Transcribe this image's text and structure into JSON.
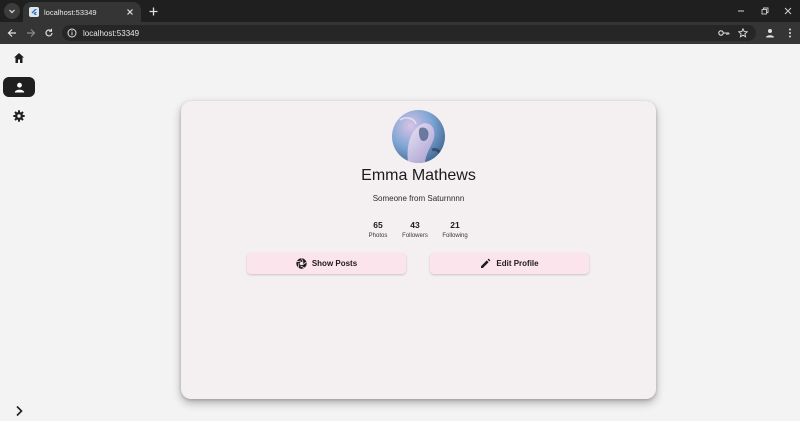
{
  "browser": {
    "tab_title": "localhost:53349",
    "url": "localhost:53349"
  },
  "nav_rail": {
    "items": [
      {
        "icon": "home-icon",
        "active": false
      },
      {
        "icon": "person-icon",
        "active": true
      },
      {
        "icon": "gear-icon",
        "active": false
      }
    ],
    "expand_icon": "chevron-right-icon"
  },
  "profile": {
    "name": "Emma Mathews",
    "bio": "Someone from Saturnnnn",
    "stats": [
      {
        "value": "65",
        "label": "Photos"
      },
      {
        "value": "43",
        "label": "Followers"
      },
      {
        "value": "21",
        "label": "Following"
      }
    ],
    "actions": {
      "show_posts": "Show Posts",
      "edit_profile": "Edit Profile"
    }
  },
  "colors": {
    "page_bg": "#f3f3f3",
    "card_bg": "#f4eff1",
    "button_bg": "#fbe4ec",
    "active_rail": "#1f1f1f"
  }
}
